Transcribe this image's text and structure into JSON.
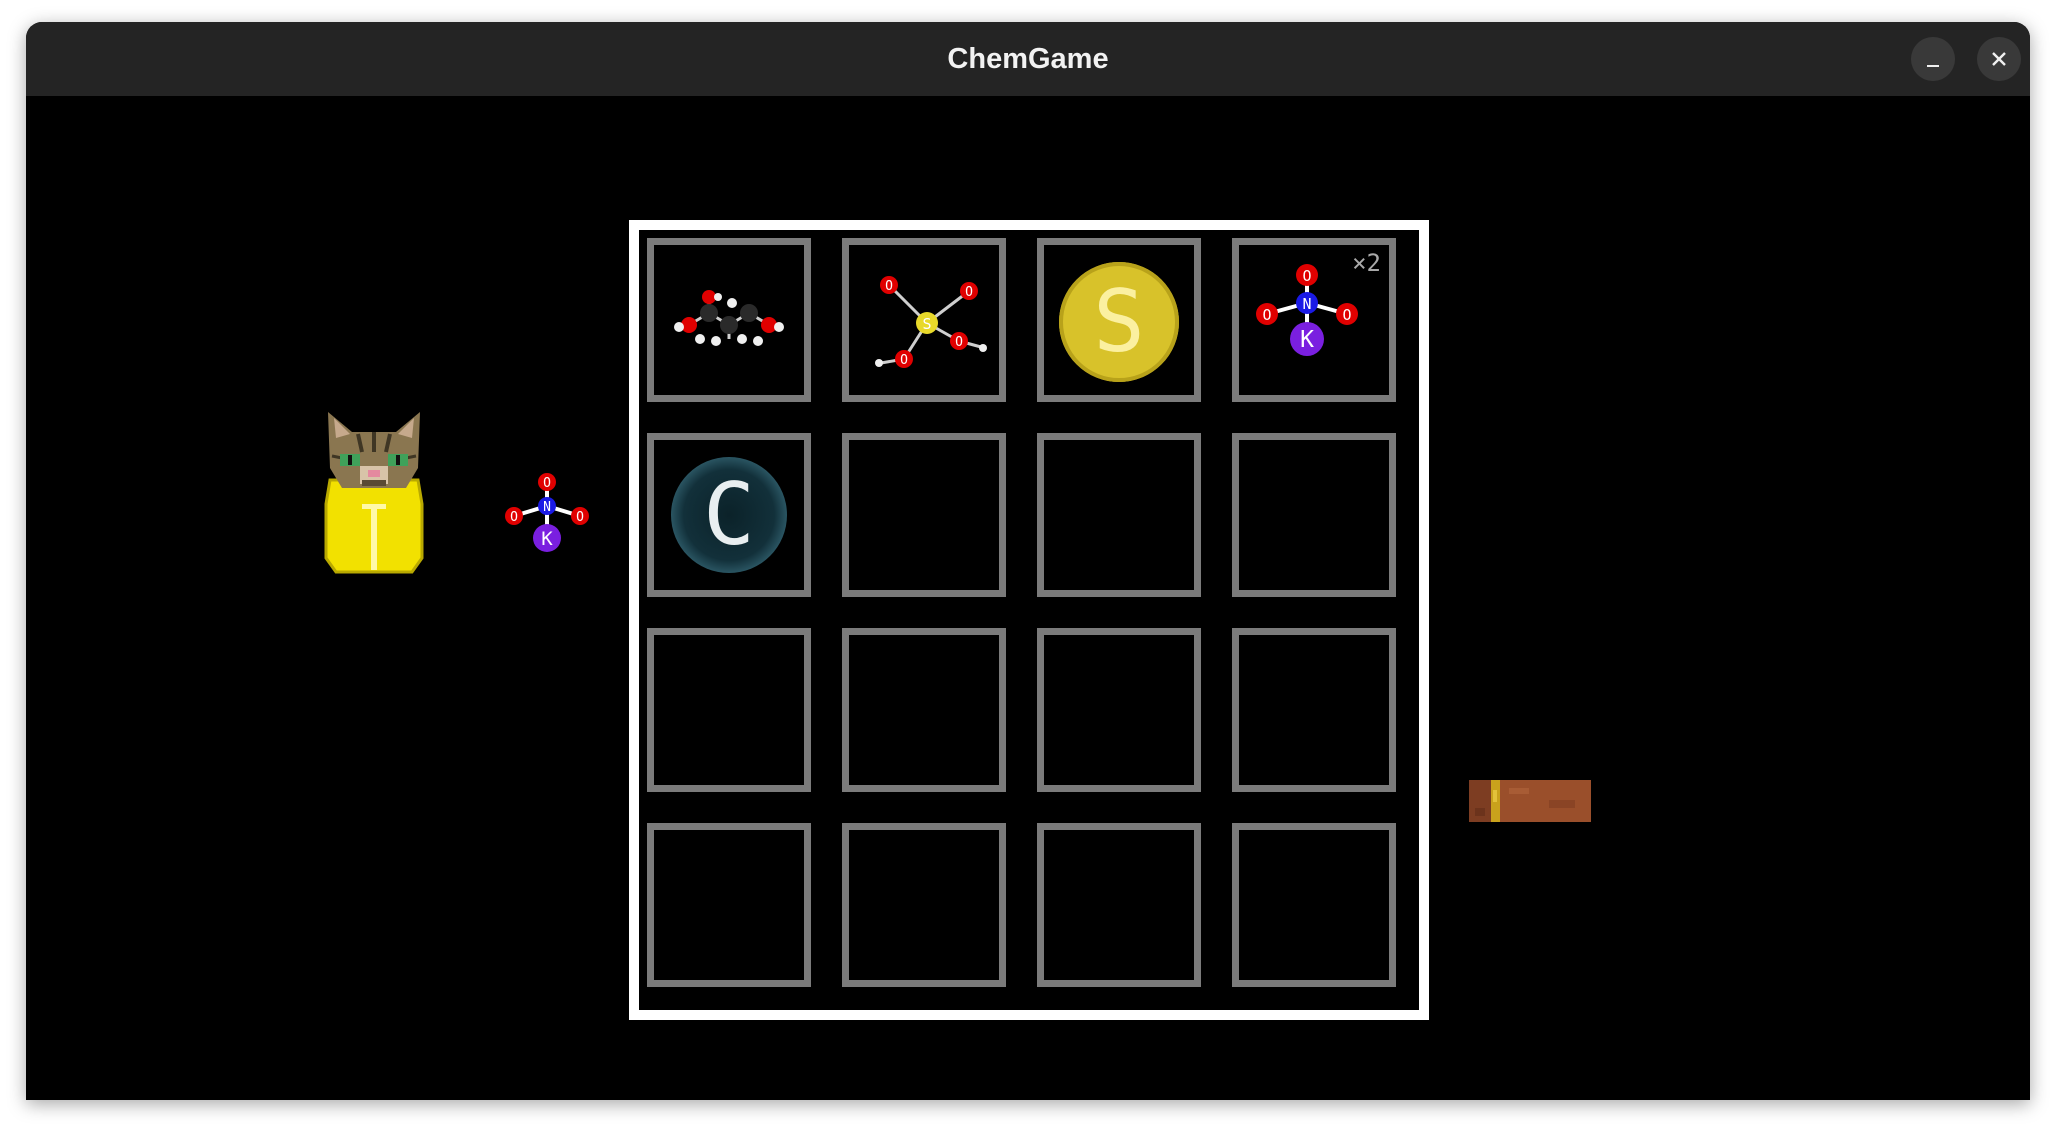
{
  "window": {
    "title": "ChemGame",
    "controls": {
      "minimize": "minimize-icon",
      "close": "close-icon"
    }
  },
  "player": {
    "sprite": "cat-in-yellow-hazmat-suit",
    "held_item": {
      "molecule": "potassium-nitrate",
      "atoms": [
        "O",
        "N",
        "O",
        "O",
        "K"
      ]
    }
  },
  "inventory": {
    "rows": 4,
    "columns": 4,
    "slots": [
      {
        "item": "glycerol-molecule"
      },
      {
        "item": "sulfuric-acid-molecule",
        "atoms": [
          "O",
          "S",
          "O",
          "O",
          "O"
        ]
      },
      {
        "item": "sulfur",
        "symbol": "S"
      },
      {
        "item": "potassium-nitrate",
        "atoms": [
          "O",
          "N",
          "O",
          "O",
          "K"
        ],
        "count": "×2"
      },
      {
        "item": "carbon",
        "symbol": "C"
      },
      {},
      {},
      {},
      {},
      {},
      {},
      {},
      {},
      {},
      {},
      {}
    ]
  },
  "world_object": "wooden-log",
  "colors": {
    "oxygen": "#e00000",
    "nitrogen": "#1a1ae6",
    "potassium": "#7a1fe0",
    "sulfur": "#e8d92a",
    "carbon": "#16323b",
    "slot_border": "#7b7b7b",
    "board_border": "#ffffff"
  }
}
